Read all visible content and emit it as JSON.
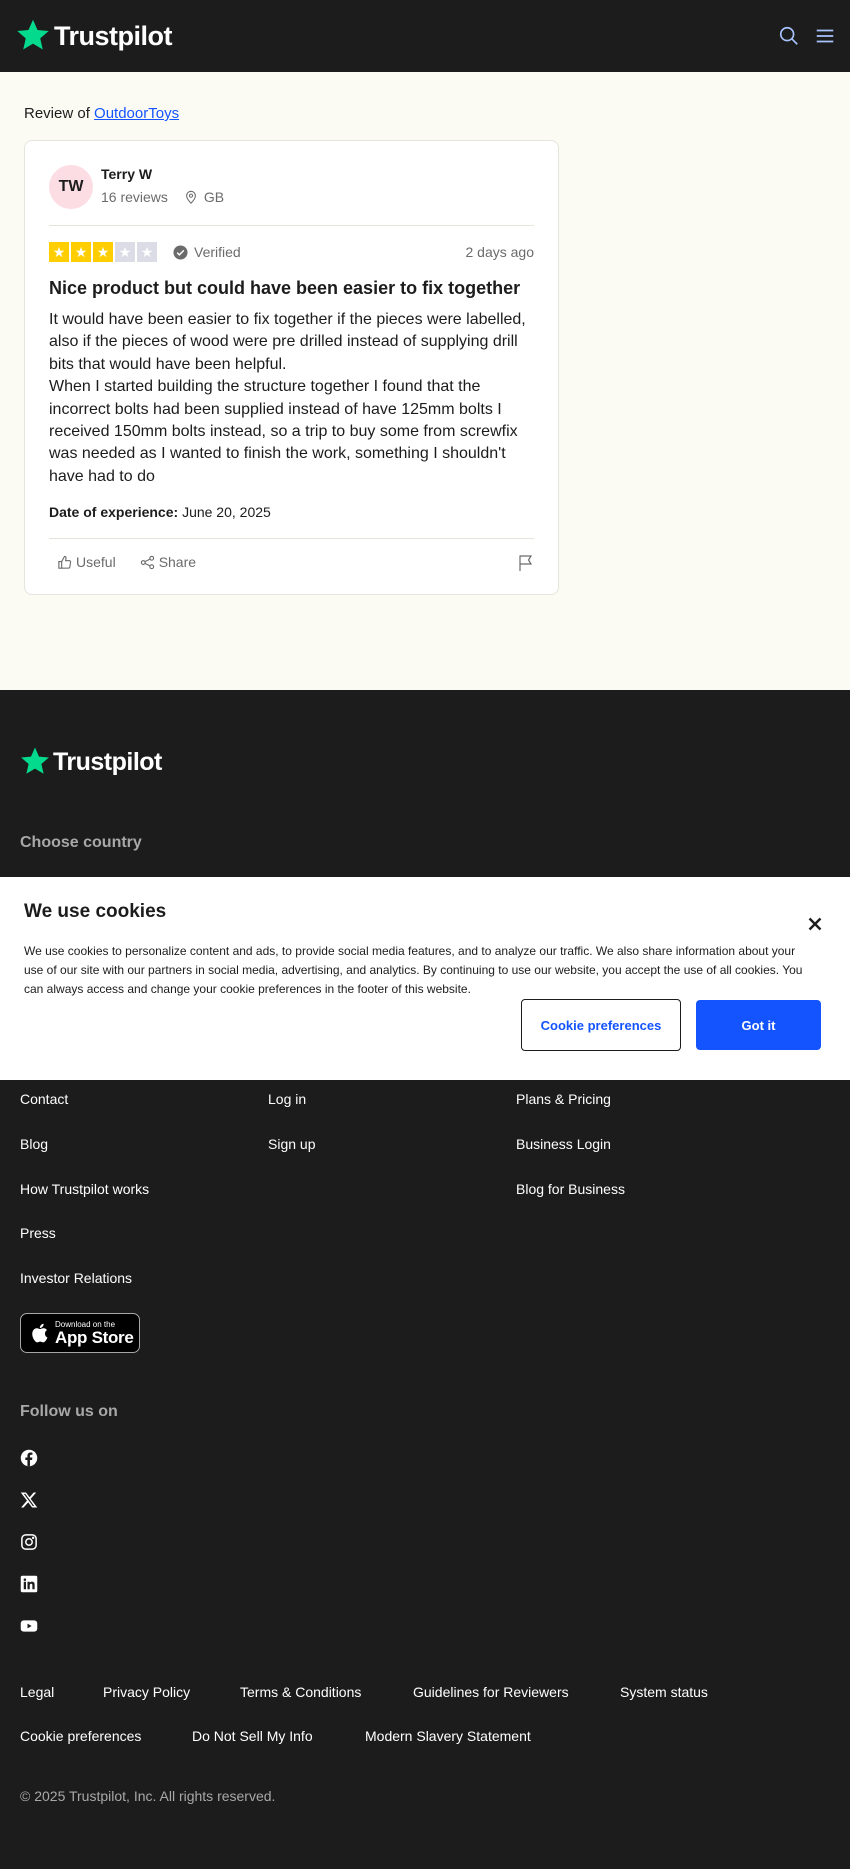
{
  "header": {
    "brand": "Trustpilot",
    "icons": [
      "search-icon",
      "menu-icon"
    ]
  },
  "review_page": {
    "review_of_prefix": "Review of",
    "company": "OutdoorToys",
    "review": {
      "initials": "TW",
      "author": "Terry W",
      "review_count": "16 reviews",
      "country": "GB",
      "rating": 3,
      "rating_max": 5,
      "verified_label": "Verified",
      "date_ago": "2 days ago",
      "title": "Nice product but could have been easier to fix together",
      "body": "It would have been easier to fix together if the pieces were labelled, also if the pieces of wood were pre drilled instead of supplying drill bits that would have been helpful.\nWhen I started building the structure together I found that the incorrect bolts had been supplied instead of have 125mm bolts I received 150mm bolts instead, so a trip to buy some from screwfix was needed as I wanted to finish the work, something I shouldn't have had to do",
      "experience_label": "Date of experience:",
      "experience_date": "June 20, 2025",
      "useful_label": "Useful",
      "share_label": "Share"
    }
  },
  "colors": {
    "brand_green": "#04da8d",
    "star_filled": "#ffce00",
    "star_empty": "#dcdce6",
    "link_blue": "#1454ff",
    "dark_bg": "#1c1c1c",
    "page_bg": "#fcfbf3"
  },
  "footer": {
    "brand": "Trustpilot",
    "choose_country": "Choose country",
    "col1": [
      "Contact",
      "Blog",
      "How Trustpilot works",
      "Press",
      "Investor Relations"
    ],
    "col2": [
      "Log in",
      "Sign up"
    ],
    "col3": [
      "Plans & Pricing",
      "Business Login",
      "Blog for Business"
    ],
    "app_store": {
      "small": "Download on the",
      "big": "App Store"
    },
    "follow_us": "Follow us on",
    "social_icons": [
      "facebook-icon",
      "x-icon",
      "instagram-icon",
      "linkedin-icon",
      "youtube-icon"
    ],
    "legal_row1": [
      "Legal",
      "Privacy Policy",
      "Terms & Conditions",
      "Guidelines for Reviewers",
      "System status"
    ],
    "legal_row2": [
      "Cookie preferences",
      "Do Not Sell My Info",
      "Modern Slavery Statement"
    ],
    "copyright": "© 2025 Trustpilot, Inc. All rights reserved."
  },
  "cookie_banner": {
    "title": "We use cookies",
    "text": "We use cookies to personalize content and ads, to provide social media features, and to analyze our traffic. We also share information about your use of our site with our partners in social media, advertising, and analytics. By continuing to use our website, you accept the use of all cookies. You can always access and change your cookie preferences in the footer of this website.",
    "preferences_button": "Cookie preferences",
    "accept_button": "Got it"
  }
}
